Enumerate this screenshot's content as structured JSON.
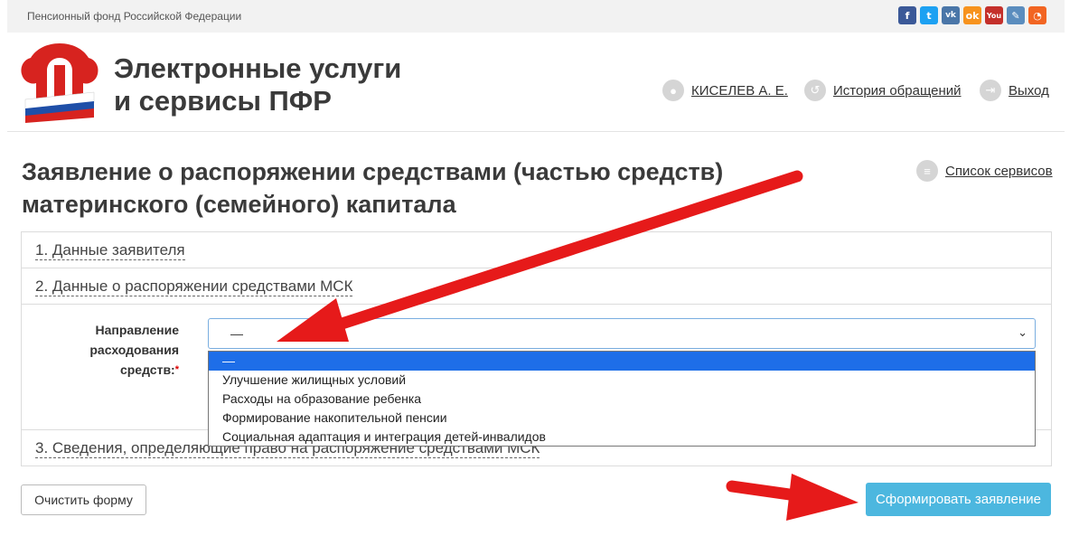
{
  "topbar": {
    "org_name": "Пенсионный фонд Российской Федерации",
    "socials": [
      {
        "icon": "facebook-icon",
        "glyph": "f",
        "color": "#3b5998"
      },
      {
        "icon": "twitter-icon",
        "glyph": "t",
        "color": "#1da1f2"
      },
      {
        "icon": "vk-icon",
        "glyph": "vk",
        "color": "#4a76a8"
      },
      {
        "icon": "odnoklassniki-icon",
        "glyph": "ok",
        "color": "#f7931e"
      },
      {
        "icon": "youtube-icon",
        "glyph": "You",
        "color": "#c4302b"
      },
      {
        "icon": "livejournal-icon",
        "glyph": "✎",
        "color": "#5b8dbe"
      },
      {
        "icon": "rss-icon",
        "glyph": "◔",
        "color": "#f26522"
      }
    ]
  },
  "header": {
    "title_line1": "Электронные услуги",
    "title_line2": "и сервисы ПФР",
    "user": "КИСЕЛЕВ А. Е.",
    "history": "История обращений",
    "logout": "Выход"
  },
  "page": {
    "title": "Заявление о распоряжении средствами (частью средств) материнского (семейного) капитала",
    "services_link": "Список сервисов"
  },
  "sections": {
    "s1": "1. Данные заявителя",
    "s2": "2. Данные о распоряжении средствами МСК",
    "s3": "3. Сведения, определяющие право на распоряжение средствами МСК"
  },
  "form": {
    "field_label": "Направление расходования средств:",
    "required_mark": "*",
    "selected_value": "—",
    "options": [
      "—",
      "Улучшение жилищных условий",
      "Расходы на образование ребенка",
      "Формирование накопительной пенсии",
      "Социальная адаптация и интеграция детей-инвалидов"
    ]
  },
  "buttons": {
    "clear": "Очистить форму",
    "submit": "Сформировать заявление"
  },
  "colors": {
    "accent": "#4cb7df",
    "selected_option": "#1e6ee8",
    "annotation_arrow": "#e61a1a"
  }
}
